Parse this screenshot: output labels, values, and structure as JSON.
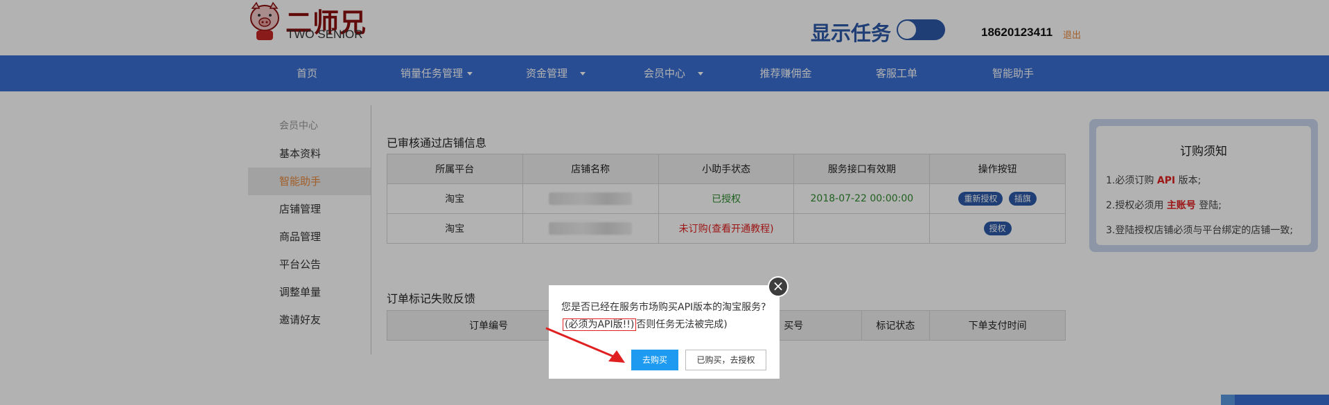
{
  "header": {
    "logo_cn": "二师兄",
    "logo_en": "TWO SENIOR",
    "show_task_label": "显示任务",
    "user_phone": "18620123411",
    "logout": "退出"
  },
  "nav": {
    "items": [
      {
        "label": "首页",
        "dropdown": false
      },
      {
        "label": "销量任务管理",
        "dropdown": true
      },
      {
        "label": "资金管理",
        "dropdown": true
      },
      {
        "label": "会员中心",
        "dropdown": true
      },
      {
        "label": "推荐赚佣金",
        "dropdown": false
      },
      {
        "label": "客服工单",
        "dropdown": false
      },
      {
        "label": "智能助手",
        "dropdown": false
      }
    ]
  },
  "sidebar": {
    "heading": "会员中心",
    "items": [
      {
        "label": "基本资料"
      },
      {
        "label": "智能助手",
        "active": true
      },
      {
        "label": "店铺管理"
      },
      {
        "label": "商品管理"
      },
      {
        "label": "平台公告"
      },
      {
        "label": "调整单量"
      },
      {
        "label": "邀请好友"
      }
    ]
  },
  "shops": {
    "title": "已审核通过店铺信息",
    "headers": [
      "所属平台",
      "店铺名称",
      "小助手状态",
      "服务接口有效期",
      "操作按钮"
    ],
    "rows": [
      {
        "platform": "淘宝",
        "status": "已授权",
        "expiry": "2018-07-22 00:00:00",
        "actions": [
          "重新授权",
          "插旗"
        ]
      },
      {
        "platform": "淘宝",
        "status_unsub": "未订购",
        "status_link": "(查看开通教程)",
        "expiry": "",
        "actions": [
          "授权"
        ]
      }
    ]
  },
  "orders": {
    "title": "订单标记失败反馈",
    "headers": [
      "订单编号",
      "",
      "买号",
      "标记状态",
      "下单支付时间"
    ]
  },
  "notice": {
    "title": "订购须知",
    "line1_pre": "1.必须订购 ",
    "line1_strong": "API",
    "line1_post": " 版本;",
    "line2_pre": "2.授权必须用 ",
    "line2_strong": "主账号",
    "line2_post": " 登陆;",
    "line3": "3.登陆授权店铺必须与平台绑定的店铺一致;"
  },
  "modal": {
    "question": "您是否已经在服务市场购买API版本的淘宝服务?",
    "required": "(必须为API版!!)",
    "warning": "否则任务无法被完成)",
    "buy_label": "去购买",
    "bought_label": "已购买，去授权",
    "close_icon": "×"
  },
  "colors": {
    "brand_blue": "#3c6fd1",
    "accent_red": "#e02020",
    "accent_orange": "#e8873a",
    "buy_button": "#1e9bf0"
  }
}
